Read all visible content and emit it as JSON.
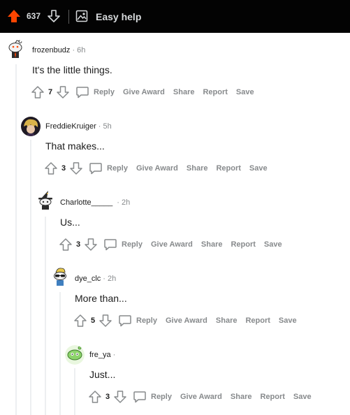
{
  "topbar": {
    "upvote_count": "637",
    "title": "Easy help",
    "colors": {
      "upvote": "#ff4500",
      "bar_bg": "#030303"
    }
  },
  "actions": {
    "reply": "Reply",
    "give_award": "Give Award",
    "share": "Share",
    "report": "Report",
    "save": "Save"
  },
  "comments": [
    {
      "author": "frozenbudz",
      "time": "· 6h",
      "body": "It's the little things.",
      "score": "7"
    },
    {
      "author": "FreddieKruiger",
      "time": "· 5h",
      "body": "That makes...",
      "score": "3"
    },
    {
      "author": "Charlotte_____",
      "time": "· 2h",
      "body": "Us...",
      "score": "3"
    },
    {
      "author": "dye_clc",
      "time": "· 2h",
      "body": "More than...",
      "score": "5"
    },
    {
      "author": "fre_ya",
      "time": "·",
      "body": "Just...",
      "score": "3"
    }
  ]
}
